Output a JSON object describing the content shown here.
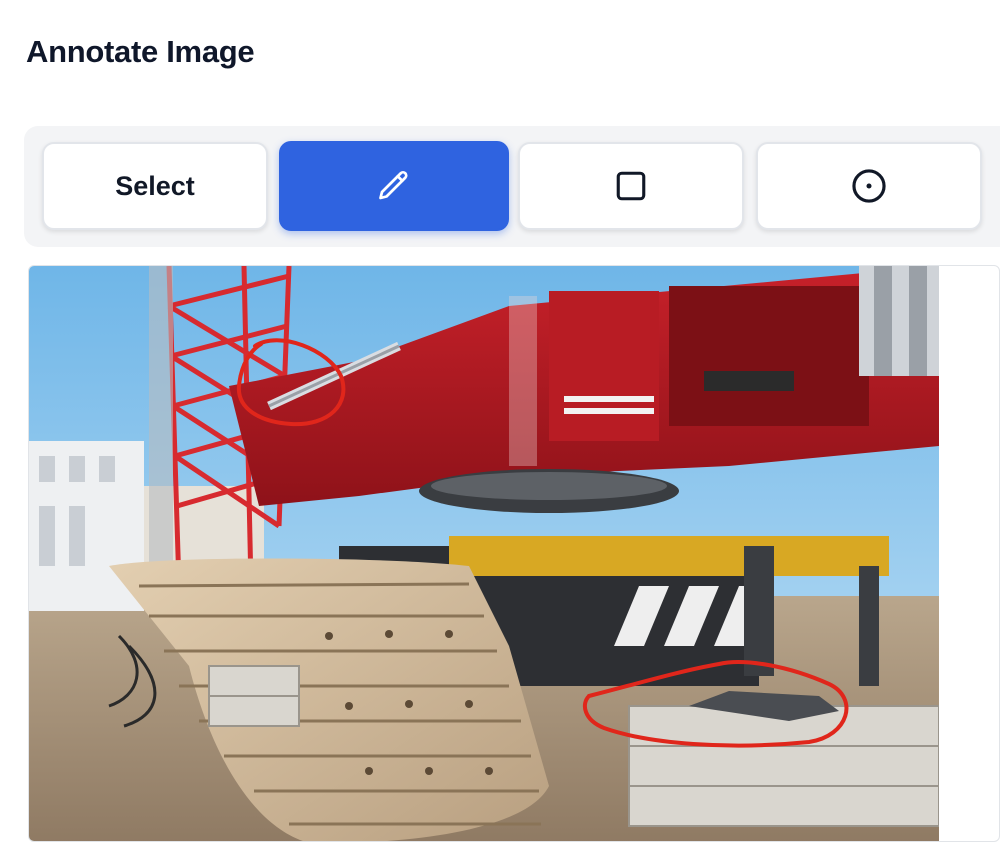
{
  "page": {
    "title": "Annotate Image"
  },
  "toolbar": {
    "tools": [
      {
        "id": "select",
        "label": "Select",
        "active": false
      },
      {
        "id": "pen",
        "icon": "pencil-icon",
        "active": true
      },
      {
        "id": "rectangle",
        "icon": "square-icon",
        "active": false
      },
      {
        "id": "circle",
        "icon": "circle-dot-icon",
        "active": false
      }
    ]
  },
  "canvas": {
    "image": "construction-crane-photo",
    "annotations": [
      {
        "tool": "pen",
        "color": "#e0261b",
        "target": "crane-boom-joint"
      },
      {
        "tool": "pen",
        "color": "#e0261b",
        "target": "outrigger-pad"
      }
    ]
  },
  "colors": {
    "accent": "#2f63e0",
    "annotation": "#e0261b"
  }
}
